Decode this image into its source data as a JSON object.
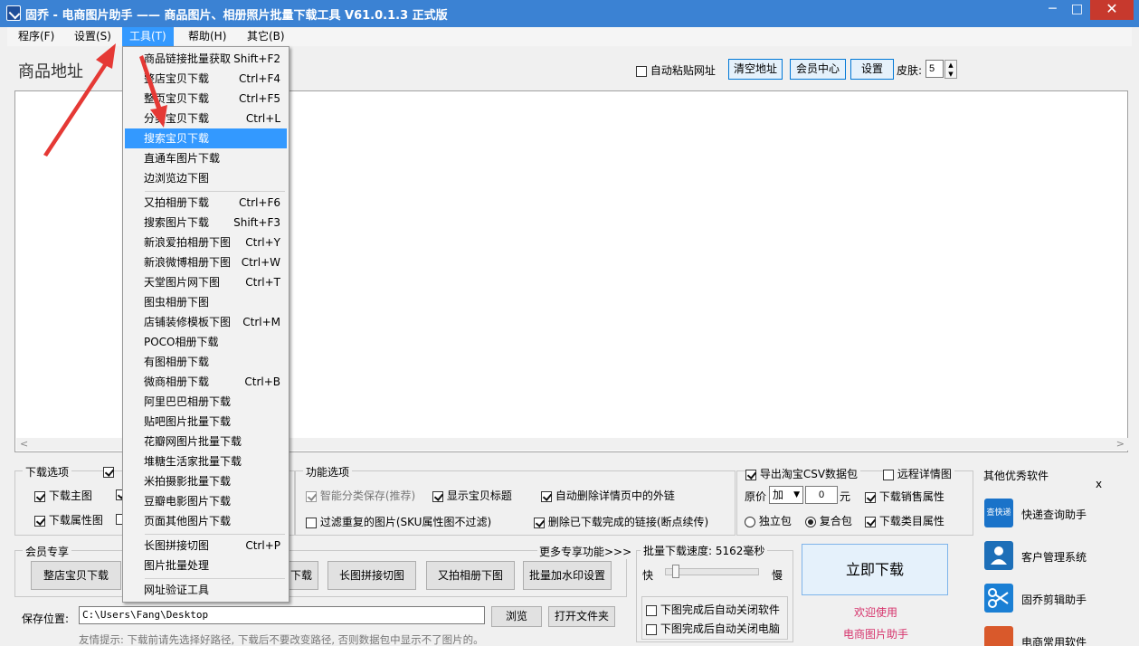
{
  "window": {
    "title": "固乔 - 电商图片助手 —— 商品图片、相册照片批量下载工具 V61.0.1.3 正式版",
    "minimize": "─",
    "maximize": "□",
    "close": "✕"
  },
  "menubar": [
    "程序(F)",
    "设置(S)",
    "工具(T)",
    "帮助(H)",
    "其它(B)"
  ],
  "top": {
    "addr_label": "商品地址",
    "auto_paste": "自动粘贴网址",
    "clear_btn": "清空地址",
    "member_btn": "会员中心",
    "settings_btn": "设置",
    "skin_label": "皮肤:",
    "skin_value": "5"
  },
  "dropdown": {
    "groups": [
      [
        {
          "label": "商品链接批量获取",
          "shortcut": "Shift+F2"
        },
        {
          "label": "整店宝贝下载",
          "shortcut": "Ctrl+F4"
        },
        {
          "label": "整页宝贝下载",
          "shortcut": "Ctrl+F5"
        },
        {
          "label": "分类宝贝下载",
          "shortcut": "Ctrl+L"
        },
        {
          "label": "搜索宝贝下载",
          "shortcut": ""
        },
        {
          "label": "直通车图片下载",
          "shortcut": ""
        },
        {
          "label": "边浏览边下图",
          "shortcut": ""
        }
      ],
      [
        {
          "label": "又拍相册下载",
          "shortcut": "Ctrl+F6"
        },
        {
          "label": "搜索图片下载",
          "shortcut": "Shift+F3"
        },
        {
          "label": "新浪爱拍相册下图",
          "shortcut": "Ctrl+Y"
        },
        {
          "label": "新浪微博相册下图",
          "shortcut": "Ctrl+W"
        },
        {
          "label": "天堂图片网下图",
          "shortcut": "Ctrl+T"
        },
        {
          "label": "图虫相册下图",
          "shortcut": ""
        },
        {
          "label": "店铺装修模板下图",
          "shortcut": "Ctrl+M"
        },
        {
          "label": "POCO相册下载",
          "shortcut": ""
        },
        {
          "label": "有图相册下载",
          "shortcut": ""
        },
        {
          "label": "微商相册下载",
          "shortcut": "Ctrl+B"
        },
        {
          "label": "阿里巴巴相册下载",
          "shortcut": ""
        },
        {
          "label": "贴吧图片批量下载",
          "shortcut": ""
        },
        {
          "label": "花瓣网图片批量下载",
          "shortcut": ""
        },
        {
          "label": "堆糖生活家批量下载",
          "shortcut": ""
        },
        {
          "label": "米拍摄影批量下载",
          "shortcut": ""
        },
        {
          "label": "豆瓣电影图片下载",
          "shortcut": ""
        },
        {
          "label": "页面其他图片下载",
          "shortcut": ""
        }
      ],
      [
        {
          "label": "长图拼接切图",
          "shortcut": "Ctrl+P"
        },
        {
          "label": "图片批量处理",
          "shortcut": ""
        }
      ],
      [
        {
          "label": "网址验证工具",
          "shortcut": ""
        }
      ]
    ]
  },
  "download_options": {
    "title": "下载选项",
    "items": [
      "下载主图",
      "下载属性图"
    ]
  },
  "function_options": {
    "title": "功能选项",
    "smart_save": "智能分类保存(推荐)",
    "show_title": "显示宝贝标题",
    "auto_delete_links": "自动删除详情页中的外链",
    "filter_dup": "过滤重复的图片(SKU属性图不过滤)",
    "delete_done": "删除已下载完成的链接(断点续传)"
  },
  "export": {
    "export_csv": "导出淘宝CSV数据包",
    "remote_detail": "远程详情图",
    "price_label": "原价",
    "price_op": "加",
    "price_value": "0",
    "price_unit": "元",
    "sales_attr": "下载销售属性",
    "standalone": "独立包",
    "combined": "复合包",
    "category_attr": "下载类目属性"
  },
  "member": {
    "title": "会员专享",
    "more": "更多专享功能>>>",
    "buttons": [
      "整店宝贝下载",
      "下载",
      "长图拼接切图",
      "又拍相册下图",
      "批量加水印设置"
    ]
  },
  "speed": {
    "label": "批量下载速度: 5162毫秒",
    "fast": "快",
    "slow": "慢",
    "auto_close_app": "下图完成后自动关闭软件",
    "auto_shutdown": "下图完成后自动关闭电脑",
    "level": 0.12
  },
  "download_now": "立即下载",
  "welcome": "欢迎使用",
  "welcome_app": "电商图片助手",
  "save": {
    "label": "保存位置:",
    "path": "C:\\Users\\Fang\\Desktop",
    "browse": "浏览",
    "open_folder": "打开文件夹",
    "hint": "友情提示: 下载前请先选择好路径, 下载后不要改变路径, 否则数据包中显示不了图片的。"
  },
  "other_software": {
    "title": "其他优秀软件",
    "close": "x",
    "items": [
      {
        "label": "快递查询助手",
        "icon": "express-icon",
        "icon_text": "查快递"
      },
      {
        "label": "客户管理系统",
        "icon": "customer-icon",
        "icon_text": ""
      },
      {
        "label": "固乔剪辑助手",
        "icon": "scissors-icon",
        "icon_text": ""
      },
      {
        "label": "电商常用软件",
        "icon": "house-icon",
        "icon_text": ""
      }
    ]
  },
  "colors": {
    "titlebar": "#3b82d3",
    "highlight": "#3399ff",
    "annotation_arrow": "#e53935",
    "welcome": "#d6336c"
  }
}
